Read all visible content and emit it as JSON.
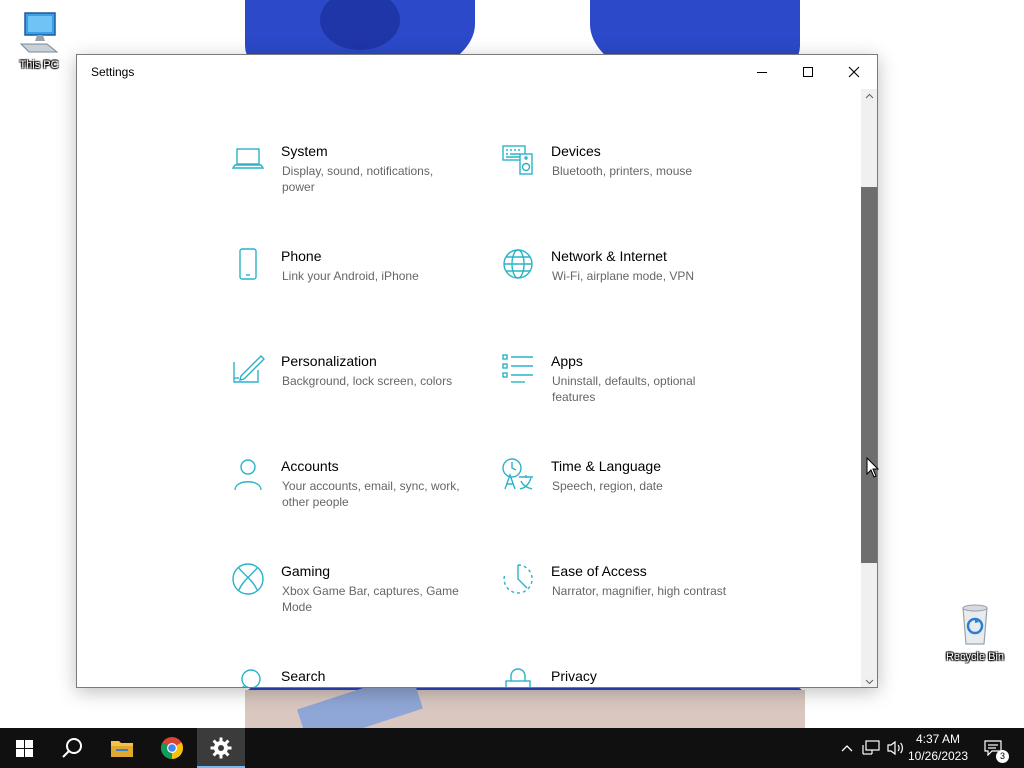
{
  "desktop": {
    "icons": [
      {
        "label": "This PC",
        "icon": "computer-icon"
      },
      {
        "label": "Recycle Bin",
        "icon": "recycle-bin-icon"
      }
    ]
  },
  "window": {
    "title": "Settings",
    "controls": {
      "minimize": "minimize-icon",
      "maximize": "maximize-icon",
      "close": "close-icon"
    }
  },
  "settings": {
    "accent": "#2ab3c8",
    "tiles": [
      {
        "name": "System",
        "desc": "Display, sound, notifications, power",
        "icon": "laptop-icon"
      },
      {
        "name": "Devices",
        "desc": "Bluetooth, printers, mouse",
        "icon": "keyboard-speaker-icon"
      },
      {
        "name": "Phone",
        "desc": "Link your Android, iPhone",
        "icon": "phone-icon"
      },
      {
        "name": "Network & Internet",
        "desc": "Wi-Fi, airplane mode, VPN",
        "icon": "globe-icon"
      },
      {
        "name": "Personalization",
        "desc": "Background, lock screen, colors",
        "icon": "pen-tablet-icon"
      },
      {
        "name": "Apps",
        "desc": "Uninstall, defaults, optional features",
        "icon": "apps-list-icon"
      },
      {
        "name": "Accounts",
        "desc": "Your accounts, email, sync, work, other people",
        "icon": "person-icon"
      },
      {
        "name": "Time & Language",
        "desc": "Speech, region, date",
        "icon": "time-language-icon"
      },
      {
        "name": "Gaming",
        "desc": "Xbox Game Bar, captures, Game Mode",
        "icon": "xbox-icon"
      },
      {
        "name": "Ease of Access",
        "desc": "Narrator, magnifier, high contrast",
        "icon": "ease-of-access-icon"
      },
      {
        "name": "Search",
        "desc": "",
        "icon": "search-icon"
      },
      {
        "name": "Privacy",
        "desc": "",
        "icon": "lock-icon"
      }
    ]
  },
  "taskbar": {
    "apps": [
      "start-icon",
      "search-icon",
      "file-explorer-icon",
      "chrome-icon",
      "settings-gear-icon"
    ],
    "clock": {
      "time": "4:37 AM",
      "date": "10/26/2023"
    },
    "notifications_count": "3"
  }
}
